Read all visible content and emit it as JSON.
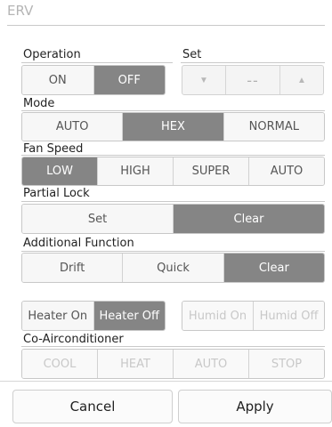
{
  "window": {
    "title": "ERV"
  },
  "operation": {
    "label": "Operation",
    "options": [
      "ON",
      "OFF"
    ]
  },
  "set": {
    "label": "Set",
    "value": "--",
    "down_icon": "triangle-down-icon",
    "up_icon": "triangle-up-icon"
  },
  "mode": {
    "label": "Mode",
    "options": [
      "AUTO",
      "HEX",
      "NORMAL"
    ]
  },
  "fan_speed": {
    "label": "Fan Speed",
    "options": [
      "LOW",
      "HIGH",
      "SUPER",
      "AUTO"
    ]
  },
  "partial_lock": {
    "label": "Partial Lock",
    "options": [
      "Set",
      "Clear"
    ]
  },
  "additional_function": {
    "label": "Additional Function",
    "options": [
      "Drift",
      "Quick",
      "Clear"
    ]
  },
  "heater": {
    "options": [
      "Heater On",
      "Heater Off"
    ]
  },
  "humid": {
    "options": [
      "Humid On",
      "Humid Off"
    ]
  },
  "co_airconditioner": {
    "label": "Co-Airconditioner",
    "options": [
      "COOL",
      "HEAT",
      "AUTO",
      "STOP"
    ]
  },
  "footer": {
    "cancel": "Cancel",
    "apply": "Apply"
  },
  "colors": {
    "selected": "#858585",
    "unselected": "#f7f7f7",
    "disabled_text": "#c8c8c8"
  }
}
